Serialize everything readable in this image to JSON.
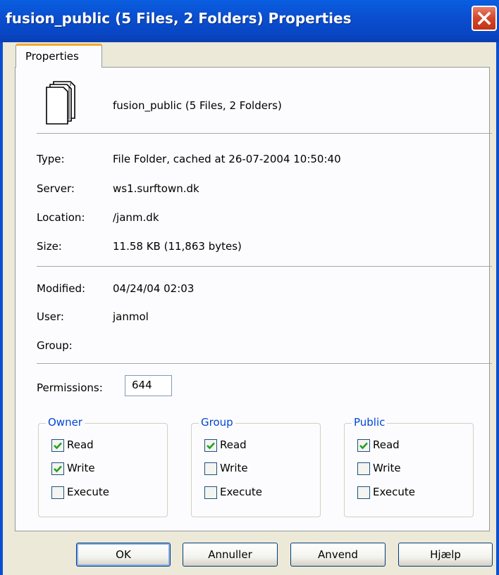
{
  "window": {
    "title": "fusion_public (5 Files, 2 Folders) Properties",
    "close_icon": "close-icon",
    "accent": "#0a4fd0"
  },
  "tab": {
    "label": "Properties"
  },
  "header": {
    "icon": "multiple-files-icon",
    "name": "fusion_public (5 Files, 2 Folders)"
  },
  "fields": {
    "type_label": "Type:",
    "type_value": "File Folder, cached at 26-07-2004 10:50:40",
    "server_label": "Server:",
    "server_value": "ws1.surftown.dk",
    "location_label": "Location:",
    "location_value": "/janm.dk",
    "size_label": "Size:",
    "size_value": "11.58 KB (11,863 bytes)",
    "modified_label": "Modified:",
    "modified_value": "04/24/04 02:03",
    "user_label": "User:",
    "user_value": "janmol",
    "group_label": "Group:",
    "group_value": ""
  },
  "permissions": {
    "label": "Permissions:",
    "value": "644",
    "groups": [
      {
        "title": "Owner",
        "read": "Read",
        "write": "Write",
        "execute": "Execute",
        "read_checked": true,
        "write_checked": true,
        "execute_checked": false
      },
      {
        "title": "Group",
        "read": "Read",
        "write": "Write",
        "execute": "Execute",
        "read_checked": true,
        "write_checked": false,
        "execute_checked": false
      },
      {
        "title": "Public",
        "read": "Read",
        "write": "Write",
        "execute": "Execute",
        "read_checked": true,
        "write_checked": false,
        "execute_checked": false
      }
    ]
  },
  "buttons": {
    "ok": "OK",
    "cancel": "Annuller",
    "apply": "Anvend",
    "help": "Hjælp"
  }
}
